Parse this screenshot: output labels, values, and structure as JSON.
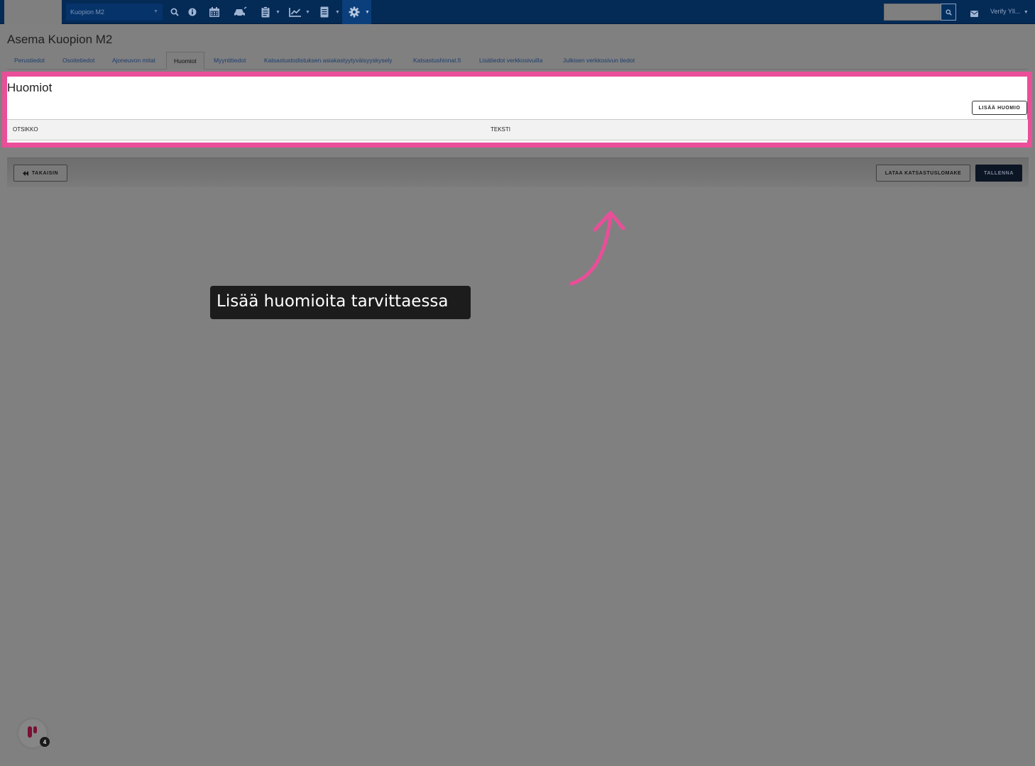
{
  "navbar": {
    "station_select": "Kuopion M2",
    "icons": [
      "search-icon",
      "info-icon",
      "calendar-icon",
      "car-icon",
      "clipboard-icon",
      "chart-icon",
      "document-icon",
      "gear-icon"
    ],
    "user_label": "Verify Yll...",
    "colors": {
      "background": "#042a56",
      "icon": "#9fb4d2"
    }
  },
  "page": {
    "title": "Asema Kuopion M2"
  },
  "tabs": [
    {
      "label": "Perustiedot",
      "active": false
    },
    {
      "label": "Osoitetiedot",
      "active": false
    },
    {
      "label": "Ajoneuvon mitat",
      "active": false
    },
    {
      "label": "Huomiot",
      "active": true
    },
    {
      "label": "Myyntitiedot",
      "active": false
    },
    {
      "label": "Katsastustodistuksen asiakastyytyväisyyskysely",
      "active": false
    },
    {
      "label": "Katsastushinnat.fi",
      "active": false
    },
    {
      "label": "Lisätiedot verkkosivuilla",
      "active": false
    },
    {
      "label": "Julkisen verkkosivun tiedot",
      "active": false
    }
  ],
  "panel": {
    "title": "Huomiot",
    "add_button": "LISÄÄ HUOMIO",
    "columns": [
      "OTSIKKO",
      "TEKSTI"
    ],
    "highlight_color": "#ea4e99"
  },
  "actions": {
    "back": "TAKAISIN",
    "download": "LATAA KATSASTUSLOMAKE",
    "save": "TALLENNA"
  },
  "tooltip": {
    "text": "Lisää huomioita tarvittaessa"
  },
  "help_widget": {
    "badge": "4"
  }
}
